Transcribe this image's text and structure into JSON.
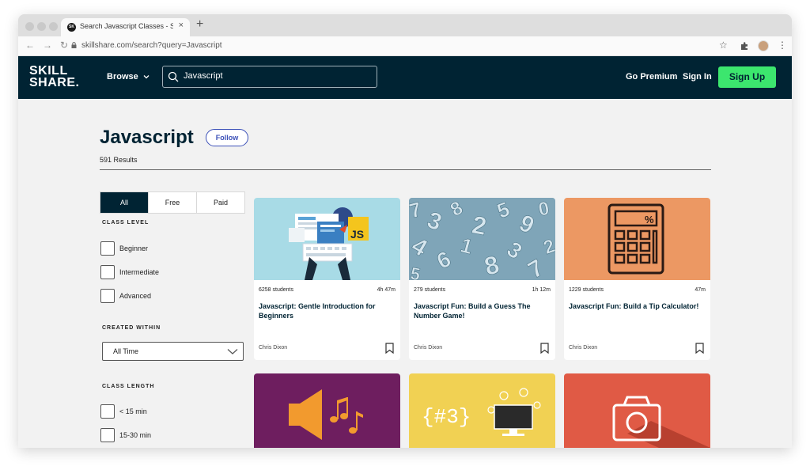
{
  "browser": {
    "tab_title": "Search Javascript Classes - Sk",
    "tab_close": "×",
    "new_tab": "+",
    "url": "skillshare.com/search?query=Javascript"
  },
  "header": {
    "logo_line1": "SKILL",
    "logo_line2": "SHARE.",
    "browse_label": "Browse",
    "search_value": "Javascript",
    "go_premium": "Go Premium",
    "sign_in": "Sign In",
    "sign_up": "Sign Up"
  },
  "page": {
    "title": "Javascript",
    "follow": "Follow",
    "results": "591 Results"
  },
  "filters": {
    "price_tabs": [
      "All",
      "Free",
      "Paid"
    ],
    "level_label": "CLASS LEVEL",
    "levels": [
      "Beginner",
      "Intermediate",
      "Advanced"
    ],
    "created_label": "CREATED WITHIN",
    "created_value": "All Time",
    "length_label": "CLASS LENGTH",
    "lengths": [
      "< 15 min",
      "15-30 min"
    ]
  },
  "cards": [
    {
      "students": "6258 students",
      "duration": "4h 47m",
      "title": "Javascript: Gentle Introduction for Beginners",
      "author": "Chris Dixon",
      "thumb_color": "#a8dbe6"
    },
    {
      "students": "279 students",
      "duration": "1h 12m",
      "title": "Javascript Fun: Build a Guess The Number Game!",
      "author": "Chris Dixon",
      "thumb_color": "#8fb2c4"
    },
    {
      "students": "1229 students",
      "duration": "47m",
      "title": "Javascript Fun: Build a Tip Calculator!",
      "author": "Chris Dixon",
      "thumb_color": "#ec9863"
    }
  ],
  "cards_row2": [
    {
      "thumb_color": "#6e1e5f"
    },
    {
      "thumb_color": "#f1d153",
      "label": "{#3}"
    },
    {
      "thumb_color": "#e05a45"
    }
  ],
  "colors": {
    "header_bg": "#002333",
    "sign_up": "#3ce66e",
    "follow": "#3b50b8"
  }
}
